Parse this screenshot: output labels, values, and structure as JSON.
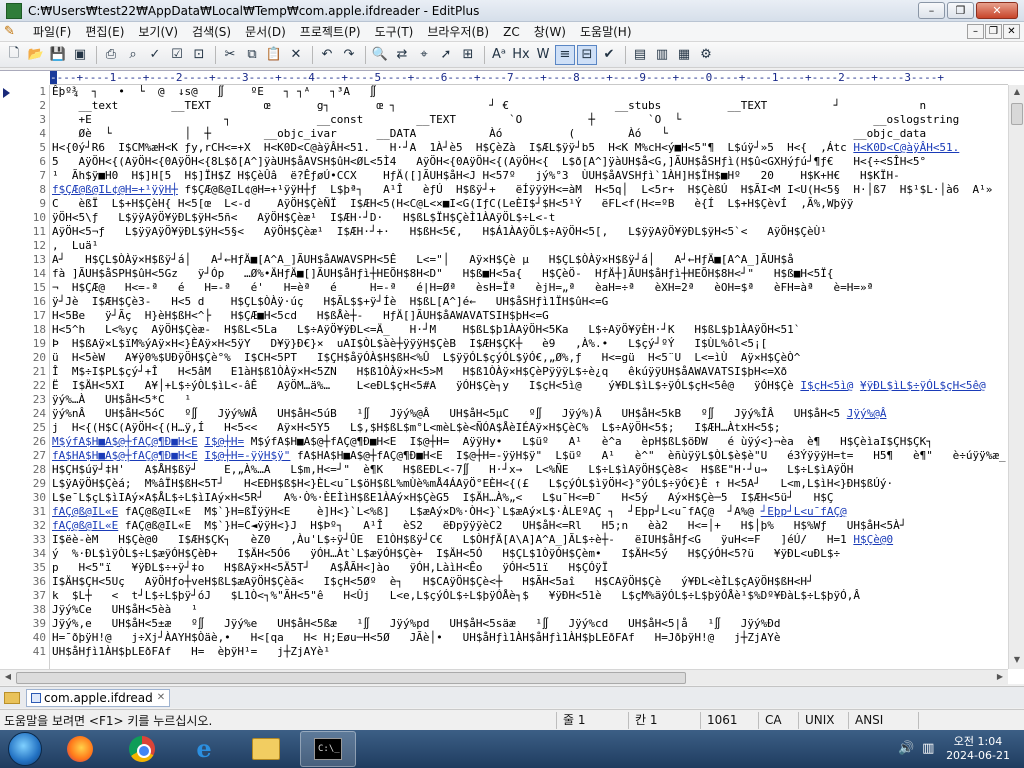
{
  "window": {
    "title": "C:₩Users₩test22₩AppData₩Local₩Temp₩com.apple.ifdreader - EditPlus",
    "minimize": "–",
    "maximize": "❐",
    "close": "✕"
  },
  "menu": {
    "items": [
      "파일(F)",
      "편집(E)",
      "보기(V)",
      "검색(S)",
      "문서(D)",
      "프로젝트(P)",
      "도구(T)",
      "브라우저(B)",
      "ZC",
      "창(W)",
      "도움말(H)"
    ],
    "mdi_minimize": "–",
    "mdi_restore": "❐",
    "mdi_close": "✕"
  },
  "ruler": {
    "cursor": "-",
    "text": "---+----1----+----2----+----3----+----4----+----5----+----6----+----7----+----8----+----9----+----0----+----1----+----2----+----3----+"
  },
  "editor": {
    "line_numbers": [
      "1",
      "2",
      "3",
      "4",
      "5",
      "6",
      "7",
      "8",
      "9",
      "10",
      "11",
      "12",
      "13",
      "14",
      "15",
      "16",
      "17",
      "18",
      "19",
      "20",
      "21",
      "22",
      "23",
      "24",
      "25",
      "26",
      "27",
      "28",
      "29",
      "30",
      "31",
      "32",
      "33",
      "34",
      "35",
      "36",
      "37",
      "38",
      "39",
      "40",
      "41"
    ],
    "lines": [
      "Êþº¾  ┐   •  └  @  ↓s@   ∬    ºE   ┐ ┐ᴬ   ┐³A   ∬",
      "    __text        __TEXT        œ       g┐       œ ┐              ┘ €                __stubs          __TEXT          ┘            n",
      "    +E                    ┐             __const        __TEXT        `O          ┼        `O  └                             __oslogstring",
      "    Øè  └           │  ┼        __objc_ivar      __DATA           Àó          (        Àó   └                            __objc_data",
      "H<{0ý┘R6  I$CM%æH<K ƒy,rCH<=+X  H<K0D<C@àÿÂH<51.   H·┘A  1À┘è5  H$ÇèZà  I$ÆL$ÿÿ┘b5  H<K M%cH<ý■H<5\"¶  L$úÿ┘»5  H<{  ,Átc",
      "5   AÿÖH<{(AÿÖH<{0AÿÖH<{8L$ð[A^]ÿàUH$åAVSH$ûH<ØL<5Ì4   AÿÖH<{0AÿÖH<{(AÿÖH<{  L$ð[A^]ÿàUH$å<G,]ÃUH$åSHƒì(H$û<GXHýƒú┘¶ƒ€   H<{÷<SÎH<5°",
      "¹  Ãh$ÿ■H0  H$]H[5  H$]ÏH$Z H$ÇèÛâ  ë?ÊƒøÚ•CCX    HƒÄ([]ÃUH$åH<J H<57º   jý%°3  ÙUH$åAVSHƒì`1ÀH]H$ÏH$■Hº   20    H$K+H€   H$KÏH-",
      "f$ÇÆ@ß@IL¢@H=+¹ÿÿH┼ƒ  L$þª┐   A¹Î   èƒÚ  H$ßÿ┘+   ëÍÿÿÿH<=àM  H<5q│  L<5r+  H$ÇèßÚ  H$ÃI<M I<U(H<5§  H·│ß7  H$¹$L·│à6  A¹»",
      "C   èßÏ  L$+H$ÇèH{ H<5[œ  L<-d    AÿÖH$ÇèÑÏ  I$ÆH<5(H<C@L<×■I<G(IƒC(LeÈI$┘$H<5¹Ý   ëFL<f(H<=ºB   è{Í  L$+H$ÇèvÍ  ,Ã%,Wþÿÿ",
      "ÿÖH<5\\ƒ   L$ÿÿAÿÖ¥ÿÐL$ÿH<5ñ<   AÿÖH$Çèæ¹  I$ÆH·┘D·   H$ßL$ÏH$ÇèÌ1ÀAÿÖL$÷L<-t",
      "AÿÖH<5¬ƒ   L$ÿÿAÿÖ¥ÿÐL$ÿH<5§<   AÿÖH$Çèæ¹  I$ÆH·┘+·   H$ßH<5€,   H$Á1ÀAÿÖL$÷AÿÖH<5[,   L$ÿÿAÿÖ¥ÿÐL$ÿH<5`<   AÿÖH$ÇèÙ¹",
      ",  Luä¹",
      "A┘   H$ÇL$ÒÀÿ×H$ßÿ┘á│   A┘←HƒÄ■[A^A_]ÃUH$åAWAVSPH<5Ê   L<=\"│   Aÿ×H$Çè µ   H$ÇL$ÒÀÿ×H$ßÿ┘á│   A┘←HƒÄ■[A^A_]ÃUH$å",
      "fà ]ÃUH$åSPH$ûH<5Gz   ÿ┘Óp   …Ø%•ÄHƒÄ■[]ÃUH$åHƒì┼HEÕH$8H<D\"   H$ß■H<5a{   H$ÇèÖ-  HƒÄ┼]ÃUH$åHƒì┼HEÕH$8H<┘\"   H$ß■H<5Ï{",
      "¬  H$ÇÆ@   H<=-ª   é   H=-ª   é'   H=èª   é     H=-ª   é|H=Øª   èsH=Ïª   èjH=„ª   èaH=÷ª   èXH=2ª   èOH=$ª   èFH=àª   è=H=»ª",
      "ÿ┘Jè  I$ÆH$Çè3-   H<5 d    H$ÇL$ÒÀÿ·úç   H$ÃL$$+ÿ┘Íè  H$ßL[A^]é←   UH$åSHƒì1ÏH$ûH<=G",
      "H<5Be   ÿ┘Ãç  H}èH$ßH<^├   H$ÇÆ■H<5cd   H$ßÅè┼-   HƒÄ[]ÃUH$åAWAVATSIH$þH<=G",
      "H<5^h   L<%yç  AÿÖH$Çèæ-  H$ßL<5La   L$÷AÿÖ¥ÿÐL<=Ä_   H·┘M    H$ßL$þ1ÀAÿÖH<5Ka   L$÷AÿÖ¥ÿÈH·┘K   H$ßL$þ1ÀAÿÖH<51`",
      "Þ  H$ßAÿ×L$ïM%ýAÿ×H<}ÈAÿ×H<5ÿY   D¥ÿ}Đ€}×  uAI$ÒL$àè┼ÿÿÿH$ÇèB  I$ÆH$ÇK┼   è9   ,À%.•   L$çý┘ºÝ   I$ÙL%ôl<5¡[",
      "ü  H<5èW   A¥ÿ0%$UÐÿÖH$Çè°%  I$CH<5PT   I$ÇH$åÿÓÀ$H$ßH<%Û  L$ÿÿÓL$çýÓL$ÿÓ€,„Ø%,ƒ   H<=gü  H<5¨U  L<=ìÙ  Aÿ×H$ÇèÒ^",
      "Î  M$÷I$PL$çý┘+Î   H<5âM   E1àH$ß1ÒÀÿ×H<5ZN   H$ß1ÒÀÿ×H<5>M   H$ß1ÒÀÿ×H$ÇèPÿÿÿL$÷è¿q   êkúÿÿUH$åAWAVATSI$þH<=Xð",
      "Ë  I$ÄH<5XI   A¥│+L$÷ýÒL$ìL<-âÊ   AÿÖM…ä%…    L<eÐL$çH<5#A   ÿÓH$Çè┐y   I$çH<5ì@    ý¥ÐL$ìL$÷ÿÓL$çH<5ê@   ÿÓH$Çè",
      "ÿý%…À   UH$åH<5*C   ¹",
      "ÿý%nÂ   UH$åH<5óC   º∬   Jÿý%WÂ   UH$åH<5úB   ¹∬   Jÿý%@Â   UH$åH<5µC   º∬   Jÿý%)Â   UH$åH<5kB   º∬   Jÿý%ÎÂ   UH$åH<5",
      "j  H<{(H$C(AÿÖH<{(H…ÿ,Í   H<5<<   Aÿ×H<5Y5   L$,$H$ßL$m°L<mèL$è<ÑÓA$ÅèIÉAÿ×H$ÇèC%  L$÷AÿÖH<5$;   I$ÆH…ÀtxH<5$;",
      "M$ýfA$H■A$@┼fAÇ@¶Ð■H<E  I$@┼H=  AÿÿHy•   L$üº   A¹   è^a   èpH$ßL$öÐW   é ùÿý<}¬èa  è¶   H$ÇèìaI$ÇH$ÇK┐",
      "fA$HA$H■A$@┼fAÇ@¶Ð■H<E  I$@┼H=-ÿÿH$ÿ\"  L$üº   A¹   è^\"  èñùÿÿL$ÒL$è$è\"U   é3ÝÿÿÿH=t=   H5¶   è¶\"   è÷úÿÿ%æ_  UH$åH<=+Ö",
      "H$ÇH$úÿ┘‡H'   A$ÅH$ßÿ┘    E,„À%…A   L$m,H<=┘\"  è¶K   H$ßEÐL<-7∬   H·┘x→  L<%ÑE   L$÷L$ìAÿÖH$Çè8<  H$ßE\"H·┘u→   L$÷L$ìAÿÖH",
      "L$ÿAÿÖH$Çèá;  M%âÏH$ßH<5T┘   H<EÐH$ß$H<}ÈL<u¯L$öH$ßL%mÙè%mÅ4ÁAÿÖ°EÈH<{(£   L$çýÓL$ìÿÖH<}°ÿÓL$÷ÿÓ€}È ↑ H<5A┘   L<m,L$ìH<}ÐH$ßÚý·",
      "L$e¯L$çL$ìIAý×A$ÅL$÷L$ìIAý×H<5R┘   A%·Ò%·ÈEÌìH$ßE1ÀAý×H$ÇèG5  I$ÄH…À%„<   L$u¯H<=Ð¯   H<5ý   Aý×H$Çè─5  I$ÆH<5ü┘   H$Ç",
      "fAÇ@ß@IL«E  M$`}H=ßÏÿÿH<E    è]H<}`L<%ß]   L$æAý×D%·ÒH<}`L$æAý×L$·ÀLEºAÇ ┐  ┘Eþp┘L<u¯fAÇ@  ┘A%@",
      "fAÇ@ß@IL«E  M$`}H=C◄ÿÿH<}J  H$Þº┐   A¹Î   èS2   ëÐpÿÿÿèC2   UH$åH<=Rl   H5;n   èà2   H<=│+   H$│þ%   H$%Wƒ   UH$åH<5À┘",
      "I$ëè-èM   H$Çè@0   I$ÆH$ÇK┐   èZ0   ,Àu'L$÷ÿ┘ÛE  E1ÒH$ßÿ┘C€   L$ÒHƒÄ[A\\A]A^A_]ÃL$÷è┼-   ëIUH$åHƒ<G   ÿuH<=F   ]éÚ/   H=1",
      "ý  %·ÐL$ìÿÒL$÷L$æÿÓH$ÇèÐ+   I$ÄH<5Ó6   ÿÓH…Àt`L$æÿÓH$Çè+  I$ÄH<5Ó   H$ÇL$1ÒÿÓH$Çèm•   I$ÄH<5ý   H$ÇýÓH<5?ü   ¥ÿÐL<uÐL$÷",
      "p   H<5\"ï   ¥ÿÐL$÷+ÿ┘‡o   H$ßAÿ×H<5Ä5T┘   A$ÅÃH<]ào   ÿÓH,LàìH<Êo   ÿÓH<51ï   H$ÇÓÿÏ",
      "I$ÄH$ÇH<5Uç   AÿÖHƒo┼veH$ßL$æAÿÖH$Çèã<   I$çH<5Øº  è┐   H$CAÿÖH$Çè<┼   H$ÃH<5aî   H$CAÿÖH$Çè   ý¥ÐL<èÌL$çAÿÖH$ßH<H┘",
      "k  $L┼   <  t┘L$÷L$þÿ┘óJ   $L1Ò<┐%\"ÃH<5\"ê   H<Ûj   L<e,L$çýÓL$÷L$þÿÓÅè┐$   ¥ÿÐH<51è   L$çM%äÿÓL$÷L$þÿÓÅè¹$%Dº¥ÐàL$÷L$þÿÓ,Â",
      "Jÿý%Ce   UH$åH<5èà   ¹",
      "Jÿý%,e   UH$åH<5±æ   º∬   Jÿý%e   UH$åH<5ßæ   ¹∬   Jÿý%pd   UH$åH<5säæ   ¹∬   Jÿý%cd   UH$åH<5|å   ¹∬   Jÿý%Ðd",
      "H=¯ðþÿH!@   j÷Xj┘ÀAYH$Òäè,•   H<[qa   H< H;Eøu─H<5Ø   JÃè│•   UH$åHƒì1ÀH$åHƒì1ÀH$þLEðFAf   H=JðþÿH!@   j┼ZjAYè",
      "UH$åHƒì1ÀH$þLEðFAf   H=  èþÿH¹=   j┼ZjAYè¹"
    ],
    "links": {
      "line5": "H<K0D<C@àÿÂH<51.",
      "line8": "f$ÇÆ@ß@IL¢@H=+¹ÿÿH┼",
      "line22a": "I$çH<5ì@",
      "line22b": "¥ÿÐL$ìL$÷ÿÓL$çH<5ê@",
      "line24": "Jÿý%@Â",
      "line26a": "M$ýfA$H■A$@┼fAÇ@¶Ð■H<E",
      "line26b": "I$@┼H=",
      "line27a": "fA$HA$H■A$@┼fAÇ@¶Ð■H<E",
      "line27b": "I$@┼H=-ÿÿH$ÿ\"",
      "line31a": "fAÇ@ß@IL«E",
      "line31b": "┘Eþp┘L<u¯fAÇ@",
      "line32": "fAÇ@ß@IL«E",
      "line33": "H$Çè@0"
    }
  },
  "tabs": {
    "items": [
      {
        "label": "com.apple.ifdread",
        "close": "✕"
      }
    ]
  },
  "status": {
    "help": "도움말을 보려면 <F1> 키를 누르십시오.",
    "line": "줄 1",
    "col": "칸 1",
    "size": "1061",
    "ca": "CA",
    "unix": "UNIX",
    "encoding": "ANSI",
    "mode": ""
  },
  "taskbar": {
    "clock_time": "오전 1:04",
    "clock_date": "2024-06-21",
    "cmd_label": "C:\\_"
  }
}
